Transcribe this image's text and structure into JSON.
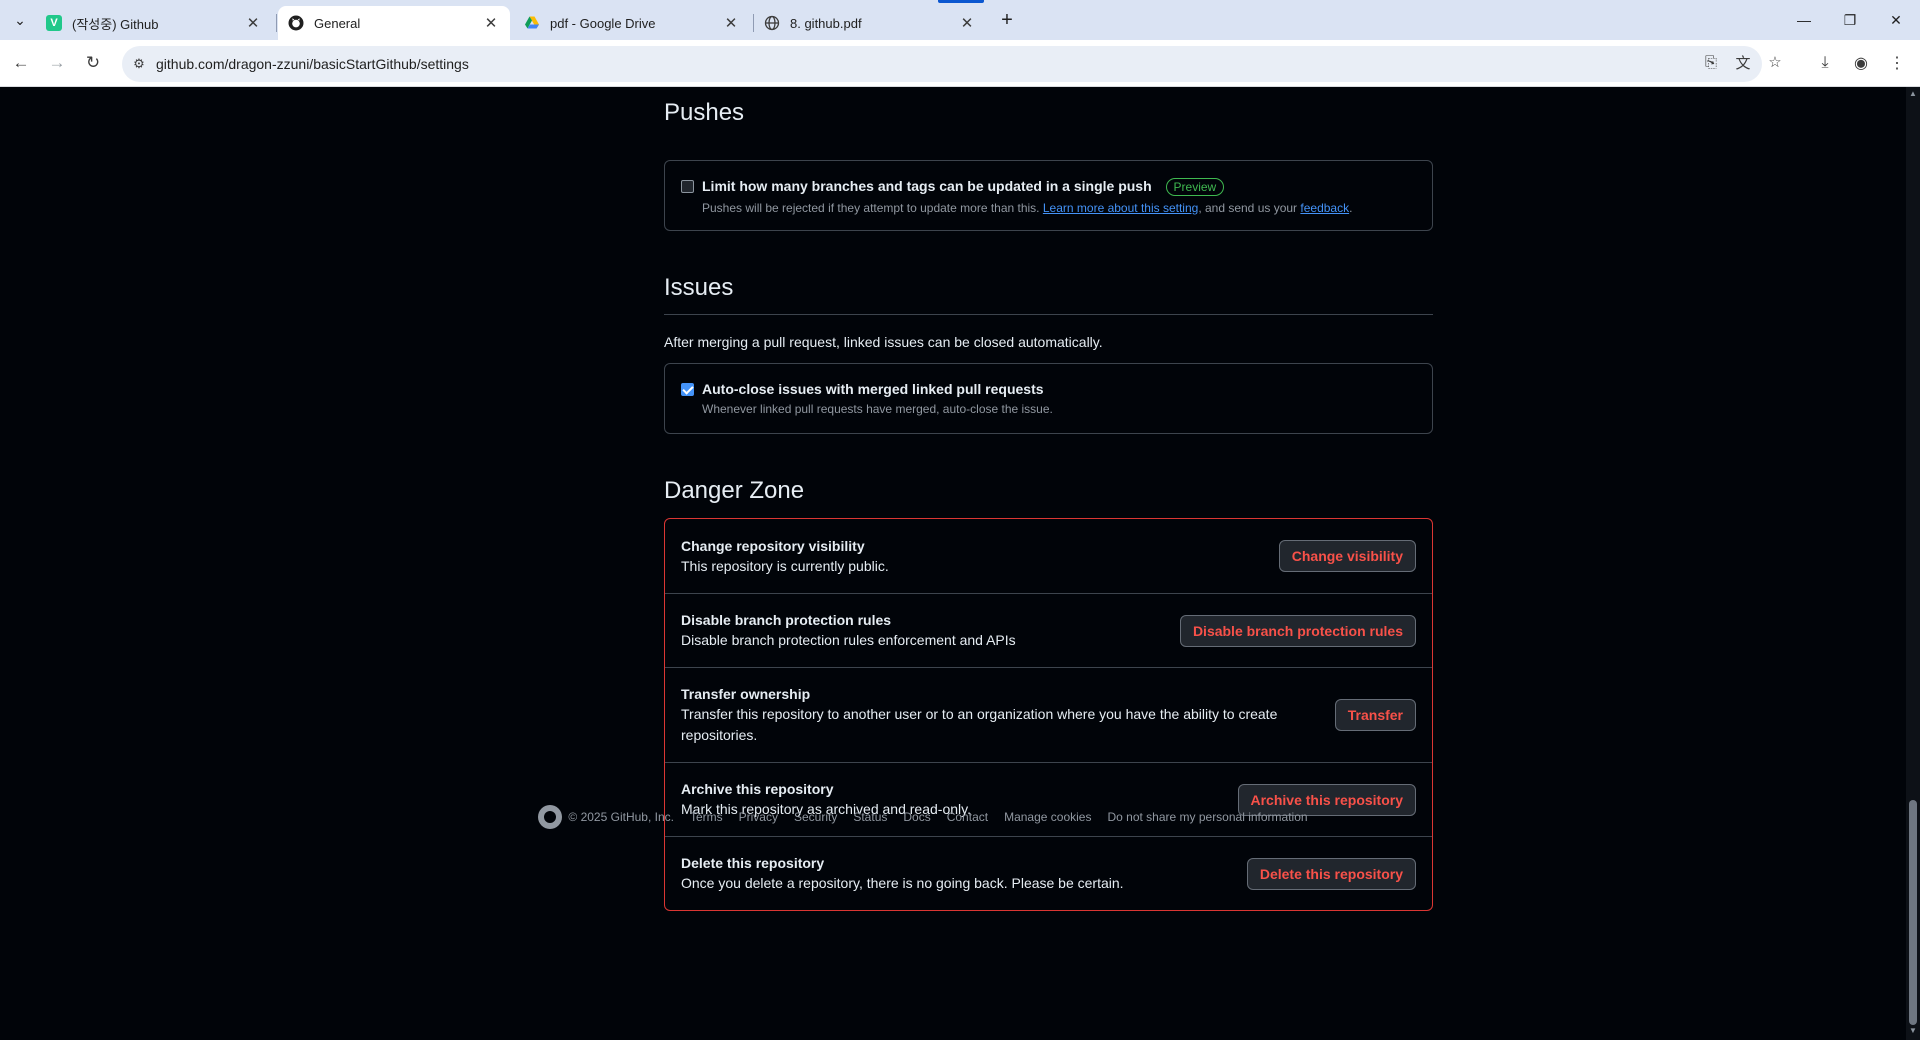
{
  "browser": {
    "tabs": [
      {
        "title": "(작성중) Github",
        "favicon": "V",
        "favicon_color": "#21c88a"
      },
      {
        "title": "General",
        "favicon": "github-icon",
        "favicon_color": "#1f1f1f",
        "active": true
      },
      {
        "title": "pdf - Google Drive",
        "favicon": "google-drive-icon",
        "favicon_color": "#fbbc04"
      },
      {
        "title": "8. github.pdf",
        "favicon": "globe-icon",
        "favicon_color": "#3c3c3c"
      }
    ],
    "url": "github.com/dragon-zzuni/basicStartGithub/settings"
  },
  "pushes": {
    "heading": "Pushes",
    "checkbox_label": "Limit how many branches and tags can be updated in a single push",
    "badge": "Preview",
    "note_prefix": "Pushes will be rejected if they attempt to update more than this.",
    "note_link": "Learn more about this setting",
    "note_middle": ", and send us your",
    "note_feedback": "feedback",
    "note_end": ".",
    "checked": false
  },
  "issues": {
    "heading": "Issues",
    "description": "After merging a pull request, linked issues can be closed automatically.",
    "checkbox_label": "Auto-close issues with merged linked pull requests",
    "note": "Whenever linked pull requests have merged, auto-close the issue.",
    "checked": true
  },
  "danger": {
    "heading": "Danger Zone",
    "rows": [
      {
        "title": "Change repository visibility",
        "desc": "This repository is currently public.",
        "button": "Change visibility"
      },
      {
        "title": "Disable branch protection rules",
        "desc": "Disable branch protection rules enforcement and APIs",
        "button": "Disable branch protection rules"
      },
      {
        "title": "Transfer ownership",
        "desc": "Transfer this repository to another user or to an organization where you have the ability to create repositories.",
        "button": "Transfer"
      },
      {
        "title": "Archive this repository",
        "desc": "Mark this repository as archived and read-only.",
        "button": "Archive this repository"
      },
      {
        "title": "Delete this repository",
        "desc": "Once you delete a repository, there is no going back. Please be certain.",
        "button": "Delete this repository"
      }
    ]
  },
  "footer": {
    "copyright": "© 2025 GitHub, Inc.",
    "links": [
      "Terms",
      "Privacy",
      "Security",
      "Status",
      "Docs",
      "Contact",
      "Manage cookies",
      "Do not share my personal information"
    ]
  },
  "colors": {
    "page_bg": "#010409",
    "danger_border": "#da3633",
    "danger_text": "#f85149",
    "link": "#4493f8",
    "preview_badge": "#3fb950"
  }
}
